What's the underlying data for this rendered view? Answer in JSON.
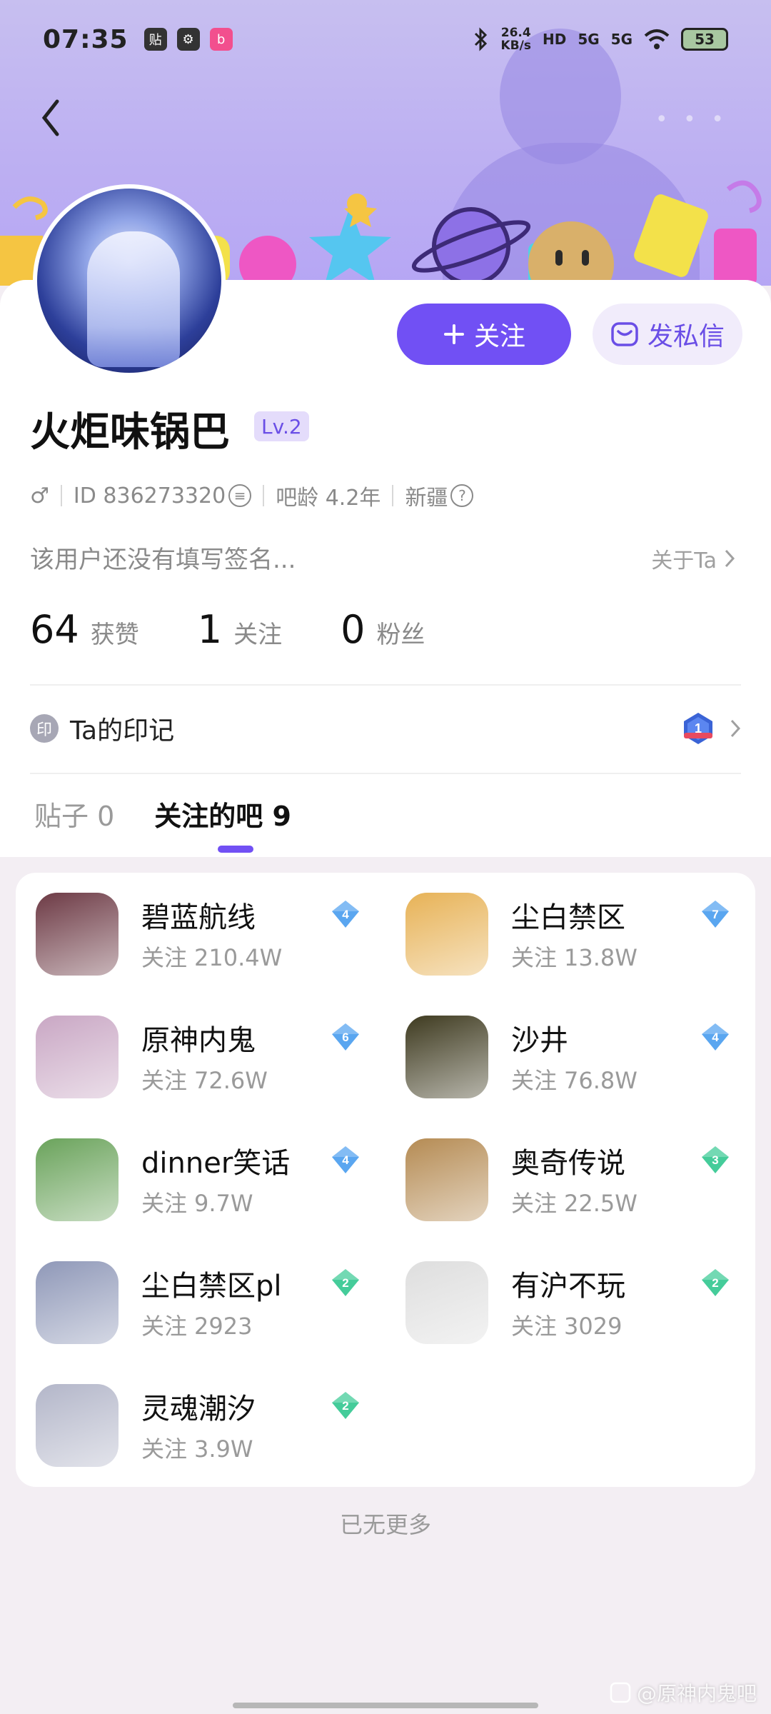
{
  "status_bar": {
    "time": "07:35",
    "apps": [
      "贴",
      "⚙",
      "b"
    ],
    "net_speed_value": "26.4",
    "net_speed_unit": "KB/s",
    "hd": "HD",
    "sig1": "5G",
    "sig2": "5G",
    "battery": "53"
  },
  "profile": {
    "username": "火炬味锅巴",
    "level": "Lv.2",
    "gender_symbol": "♂",
    "id_text": "ID 836273320",
    "forum_age": "吧龄 4.2年",
    "region": "新疆",
    "bio": "该用户还没有填写签名...",
    "about_label": "关于Ta",
    "follow_label": "关注",
    "message_label": "发私信",
    "stats": [
      {
        "num": "64",
        "label": "获赞"
      },
      {
        "num": "1",
        "label": "关注"
      },
      {
        "num": "0",
        "label": "粉丝"
      }
    ],
    "marks_icon_text": "印",
    "marks_label": "Ta的印记",
    "mark_badge_num": "1"
  },
  "tabs": [
    {
      "label": "贴子 0",
      "active": false
    },
    {
      "label": "关注的吧 9",
      "active": true
    }
  ],
  "followers_label": "关注",
  "forums": [
    {
      "name": "碧蓝航线",
      "followers": "210.4W",
      "level": "4",
      "level_color": "#5aa6f0",
      "avatar_color": "#6d3a45"
    },
    {
      "name": "尘白禁区",
      "followers": "13.8W",
      "level": "7",
      "level_color": "#5aa6f0",
      "avatar_color": "#e7b256"
    },
    {
      "name": "原神内鬼",
      "followers": "72.6W",
      "level": "6",
      "level_color": "#5aa6f0",
      "avatar_color": "#c9a7c4"
    },
    {
      "name": "沙井",
      "followers": "76.8W",
      "level": "4",
      "level_color": "#5aa6f0",
      "avatar_color": "#3e3a1f"
    },
    {
      "name": "dinner笑话",
      "followers": "9.7W",
      "level": "4",
      "level_color": "#5aa6f0",
      "avatar_color": "#6aa35b"
    },
    {
      "name": "奥奇传说",
      "followers": "22.5W",
      "level": "3",
      "level_color": "#45cc9a",
      "avatar_color": "#b58b53"
    },
    {
      "name": "尘白禁区pl",
      "followers": "2923",
      "level": "2",
      "level_color": "#45cc9a",
      "avatar_color": "#8f98b8"
    },
    {
      "name": "有沪不玩",
      "followers": "3029",
      "level": "2",
      "level_color": "#45cc9a",
      "avatar_color": "#dedede"
    },
    {
      "name": "灵魂潮汐",
      "followers": "3.9W",
      "level": "2",
      "level_color": "#45cc9a",
      "avatar_color": "#b3b6c9"
    }
  ],
  "no_more": "已无更多",
  "watermark": "@原神内鬼吧"
}
